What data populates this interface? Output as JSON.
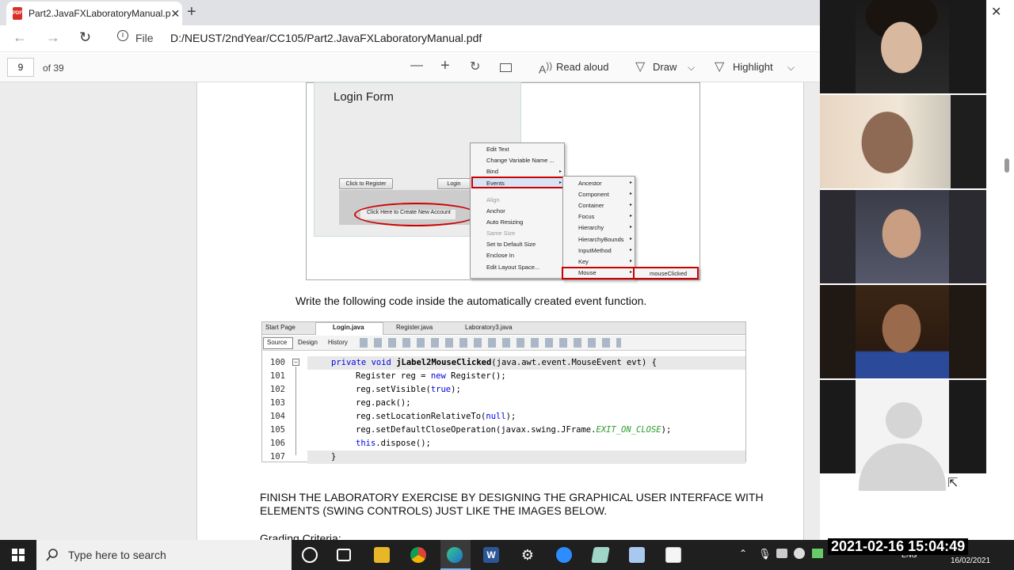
{
  "browser": {
    "tab_title": "Part2.JavaFXLaboratoryManual.p",
    "tab_close": "✕",
    "new_tab": "+",
    "file_label": "File",
    "url": "D:/NEUST/2ndYear/CC105/Part2.JavaFXLaboratoryManual.pdf",
    "overflow": "···"
  },
  "pdf_toolbar": {
    "page_number": "9",
    "page_total": "of 39",
    "read_aloud": "Read aloud",
    "draw": "Draw",
    "highlight": "Highlight"
  },
  "figure1": {
    "form_title": "Login Form",
    "btn_register": "Click to Register",
    "btn_login": "Login",
    "label_create": "Click Here to Create New Account",
    "context_menu": [
      "Edit Text",
      "Change Variable Name ...",
      "Bind",
      "Events",
      "Align",
      "Anchor",
      "Auto Resizing",
      "Same Size",
      "Set to Default Size",
      "Enclose In",
      "Edit Layout Space..."
    ],
    "events_menu": [
      "Ancestor",
      "Component",
      "Container",
      "Focus",
      "Hierarchy",
      "HierarchyBounds",
      "InputMethod",
      "Key",
      "Mouse"
    ],
    "mouse_menu": [
      "mouseClicked"
    ]
  },
  "instruction": "Write the following code inside the automatically created event function.",
  "code_figure": {
    "tabs": [
      "Start Page",
      "Login.java",
      "Register.java",
      "Laboratory3.java"
    ],
    "view_tabs": [
      "Source",
      "Design",
      "History"
    ],
    "line_numbers": [
      "100",
      "101",
      "102",
      "103",
      "104",
      "105",
      "106",
      "107"
    ],
    "lines": {
      "l100_kw": "private void",
      "l100_method": "jLabel2MouseClicked",
      "l100_rest": "(java.awt.event.MouseEvent evt) {",
      "l101_a": "Register reg = ",
      "l101_kw": "new",
      "l101_b": " Register();",
      "l102_a": "reg.setVisible(",
      "l102_kw": "true",
      "l102_b": ");",
      "l103": "reg.pack();",
      "l104_a": "reg.setLocationRelativeTo(",
      "l104_kw": "null",
      "l104_b": ");",
      "l105_a": "reg.setDefaultCloseOperation(javax.swing.JFrame.",
      "l105_it": "EXIT_ON_CLOSE",
      "l105_b": ");",
      "l106_kw": "this",
      "l106_b": ".dispose();",
      "l107": "}"
    }
  },
  "finish_text": "FINISH THE LABORATORY EXERCISE BY DESIGNING THE GRAPHICAL USER INTERFACE WITH ELEMENTS (SWING CONTROLS) JUST LIKE THE IMAGES BELOW.",
  "grading_text": "Grading Criteria:",
  "video_panel": {
    "close": "✕"
  },
  "taskbar": {
    "search_placeholder": "Type here to search",
    "lang": "ENG",
    "clock": "2021-02-16  15:04:49",
    "date": "16/02/2021"
  }
}
